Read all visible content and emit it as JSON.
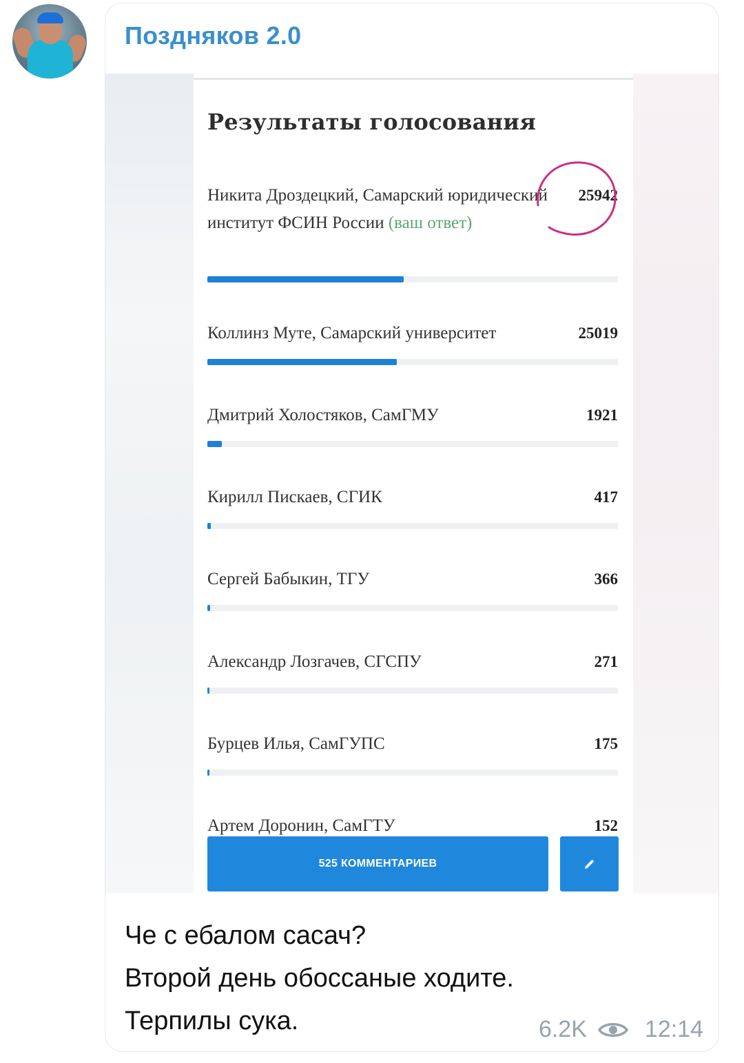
{
  "channel": {
    "name": "Поздняков 2.0"
  },
  "poll_card": {
    "title": "Результаты голосования",
    "your_answer_label": "(ваш ответ)",
    "comments_button": "525 КОММЕНТАРИЕВ",
    "edit_icon": "pencil-icon",
    "accent_color": "#1f80d5",
    "items": [
      {
        "name": "Никита Дроздецкий, Самарский юридический институт ФСИН России",
        "count": "25942",
        "fraction": 0.478,
        "is_your_answer": true,
        "circled": true
      },
      {
        "name": "Коллинз Муте, Самарский университет",
        "count": "25019",
        "fraction": 0.461,
        "is_your_answer": false
      },
      {
        "name": "Дмитрий Холостяков, СамГМУ",
        "count": "1921",
        "fraction": 0.035,
        "is_your_answer": false
      },
      {
        "name": "Кирилл Пискаев, СГИК",
        "count": "417",
        "fraction": 0.008,
        "is_your_answer": false
      },
      {
        "name": "Сергей Бабыкин, ТГУ",
        "count": "366",
        "fraction": 0.007,
        "is_your_answer": false
      },
      {
        "name": "Александр Лозгачев, СГСПУ",
        "count": "271",
        "fraction": 0.005,
        "is_your_answer": false
      },
      {
        "name": "Бурцев Илья, СамГУПС",
        "count": "175",
        "fraction": 0.003,
        "is_your_answer": false
      },
      {
        "name": "Артем Доронин, СамГТУ",
        "count": "152",
        "fraction": null,
        "is_your_answer": false
      }
    ]
  },
  "message": {
    "lines": [
      "Че с ебалом сасач?",
      "Второй день обоссаные ходите.",
      "Терпилы сука."
    ],
    "views": "6.2K",
    "views_icon": "eye-icon",
    "time": "12:14"
  }
}
